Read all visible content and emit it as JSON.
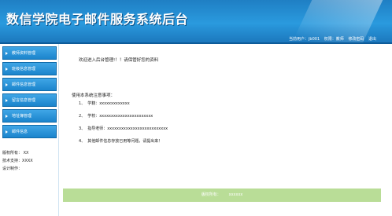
{
  "header": {
    "title": "数信学院电子邮件服务系统后台",
    "user_label": "当前用户：",
    "user_value": "jb001",
    "role_label": "权限：",
    "role_value": "教师",
    "change_password": "修改密码",
    "logout": "退出"
  },
  "sidebar": {
    "items": [
      {
        "label": "教师资料管理"
      },
      {
        "label": "班级信息管理"
      },
      {
        "label": "邮件信息管理"
      },
      {
        "label": "留言信息管理"
      },
      {
        "label": "地址簿管理"
      },
      {
        "label": "邮件信息"
      }
    ],
    "info": {
      "version_label": "版权所有：",
      "version_value": "XX",
      "support_label": "技术支持：",
      "support_value": "XXXX",
      "design_label": "设计制作："
    }
  },
  "main": {
    "welcome": "欢迎进入后台管理!！！请保管好您的资料",
    "notes_title": "使用本系统注意事项：",
    "notes": [
      {
        "num": "1、",
        "text": "学籍：",
        "value": "xxxxxxxxxxxxx"
      },
      {
        "num": "2、",
        "text": "学校：",
        "value": "xxxxxxxxxxxxxxxxxxxxxxx"
      },
      {
        "num": "3、",
        "text": "指导老师：",
        "value": "xxxxxxxxxxxxxxxxxxxxxxxxxx"
      },
      {
        "num": "4、",
        "text": "其他邮件信息存放已用等问题，请提出来！",
        "value": ""
      }
    ]
  },
  "footer": {
    "label": "版权所有：",
    "value": "xxxxxx"
  }
}
